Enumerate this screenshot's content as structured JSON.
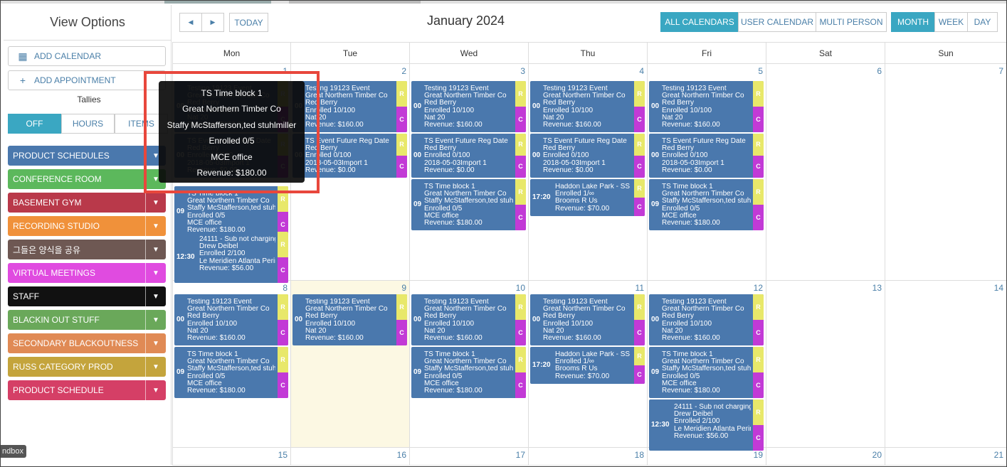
{
  "sidebar": {
    "title": "View Options",
    "add_calendar": "ADD CALENDAR",
    "add_appointment": "ADD APPOINTMENT",
    "tallies": "Tallies",
    "toggle": [
      "OFF",
      "HOURS",
      "ITEMS"
    ],
    "categories": [
      {
        "label": "PRODUCT SCHEDULES",
        "color": "#4a78ad"
      },
      {
        "label": "CONFERENCE ROOM",
        "color": "#5cb85c"
      },
      {
        "label": "BASEMENT GYM",
        "color": "#b9394a"
      },
      {
        "label": "RECORDING STUDIO",
        "color": "#f0913a"
      },
      {
        "label": "그들은 양식을 공유",
        "color": "#6e5853"
      },
      {
        "label": "VIRTUAL MEETINGS",
        "color": "#e04be0"
      },
      {
        "label": "STAFF",
        "color": "#111111"
      },
      {
        "label": "BLACKIN OUT STUFF",
        "color": "#6aa85a"
      },
      {
        "label": "SECONDARY BLACKOUTNESS",
        "color": "#e08a55"
      },
      {
        "label": "RUSS CATEGORY PROD",
        "color": "#c4a43c"
      },
      {
        "label": "PRODUCT SCHEDULE",
        "color": "#d53f66"
      }
    ]
  },
  "header": {
    "prev": "◀",
    "next": "▶",
    "today": "TODAY",
    "title": "January 2024",
    "calendar_views": [
      "ALL CALENDARS",
      "USER CALENDAR",
      "MULTI PERSON"
    ],
    "range_views": [
      "MONTH",
      "WEEK",
      "DAY"
    ]
  },
  "weekdays": [
    "Mon",
    "Tue",
    "Wed",
    "Thu",
    "Fri",
    "Sat",
    "Sun"
  ],
  "day_numbers": [
    "1",
    "2",
    "3",
    "4",
    "5",
    "6",
    "7",
    "8",
    "9",
    "10",
    "11",
    "12",
    "13",
    "14",
    "15",
    "16",
    "17",
    "18",
    "19",
    "20",
    "21"
  ],
  "events": {
    "testing": {
      "time": "00",
      "lines": [
        "Testing 19123 Event",
        "Great Northern Timber Co",
        "Red Berry",
        "Enrolled 10/100",
        "Nat 20",
        "Revenue: $160.00"
      ]
    },
    "future": {
      "time": "00",
      "lines": [
        "TS Event Future Reg Date",
        "Red Berry",
        "Enrolled 0/100",
        "2018-05-03Import 1",
        "Revenue: $0.00"
      ]
    },
    "block": {
      "time": "09",
      "lines": [
        "TS Time block 1",
        "Great Northern Timber Co",
        "Staffy McStafferson,ted stuhlmiller",
        "Enrolled 0/5",
        "MCE office",
        "Revenue: $180.00"
      ]
    },
    "haddon": {
      "time": "17:20",
      "lines": [
        "Haddon Lake Park - SS Grou",
        "Enrolled 1/∞",
        "Brooms R Us",
        "Revenue: $70.00"
      ]
    },
    "sub": {
      "time": "12:30",
      "lines": [
        "24111 - Sub not charging",
        "Drew Deibel",
        "Enrolled 2/100",
        "Le Meridien Atlanta Perimeter",
        "Revenue: $56.00"
      ]
    },
    "r": "R",
    "c": "C"
  },
  "tooltip": [
    "TS Time block 1",
    "Great Northern Timber Co",
    "Staffy McStafferson,ted stuhlmiller",
    "Enrolled 0/5",
    "MCE office",
    "Revenue: $180.00"
  ],
  "sandbox": "ndbox"
}
